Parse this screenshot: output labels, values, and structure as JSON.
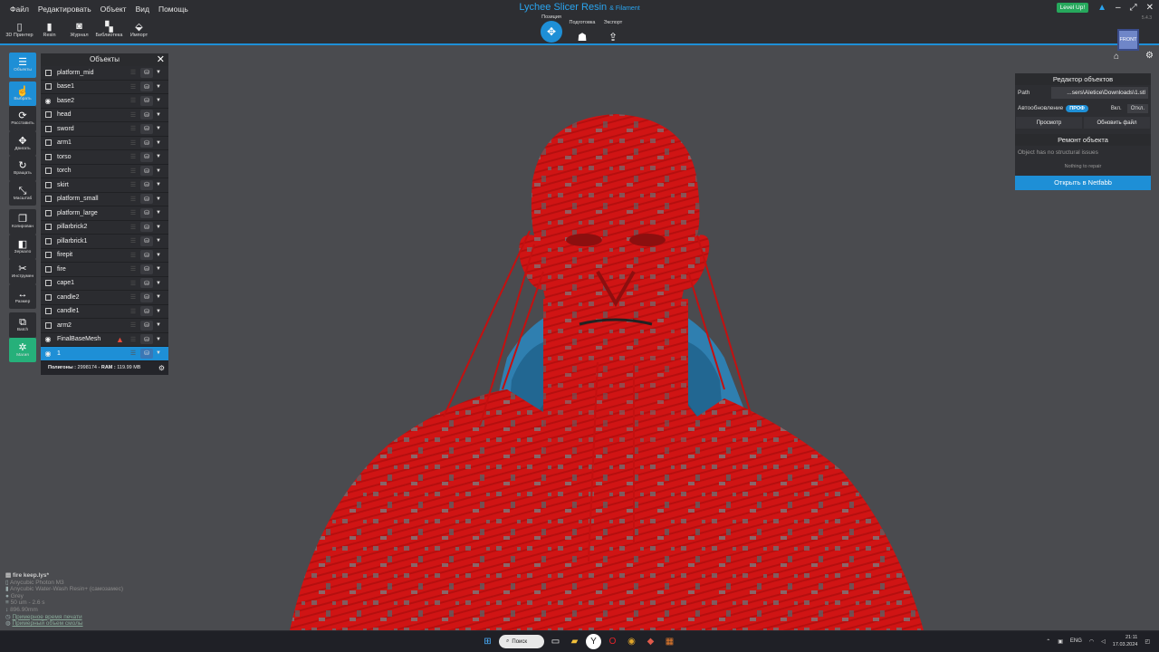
{
  "app": {
    "title": "Lychee Slicer Resin",
    "subtitle": "& Filament",
    "version": "5.4.3"
  },
  "menu": [
    "Файл",
    "Редактировать",
    "Объект",
    "Вид",
    "Помощь"
  ],
  "top_tools": [
    {
      "label": "3D Принтер",
      "icon": "printer-icon"
    },
    {
      "label": "Resin",
      "icon": "resin-bottle-icon"
    },
    {
      "label": "Журнал",
      "icon": "journal-icon"
    },
    {
      "label": "Библиотека",
      "icon": "library-icon"
    },
    {
      "label": "Импорт",
      "icon": "import-icon"
    }
  ],
  "modes": [
    {
      "label": "Позиция",
      "icon": "move-icon"
    },
    {
      "label": "Подготовка",
      "icon": "supports-icon"
    },
    {
      "label": "Экспорт",
      "icon": "export-icon"
    }
  ],
  "level_up": "Level Up!",
  "view_cube_label": "FRONT",
  "left_tools": [
    {
      "label": "Объекты",
      "icon": "objects-list-icon"
    },
    {
      "label": "Выбрать",
      "icon": "select-icon"
    },
    {
      "label": "Расставить",
      "icon": "arrange-icon"
    },
    {
      "label": "Двигать",
      "icon": "move-icon"
    },
    {
      "label": "Вращать",
      "icon": "rotate-icon"
    },
    {
      "label": "Масштаб",
      "icon": "scale-icon"
    },
    {
      "label": "Копирован",
      "icon": "copy-icon"
    },
    {
      "label": "Зеркало",
      "icon": "mirror-icon"
    },
    {
      "label": "Инструмен",
      "icon": "tools-icon"
    },
    {
      "label": "Размер",
      "icon": "size-icon"
    },
    {
      "label": "Batch",
      "icon": "batch-icon"
    },
    {
      "label": "Магия",
      "icon": "magic-icon"
    }
  ],
  "objects_panel": {
    "title": "Объекты",
    "items": [
      {
        "name": "platform_mid",
        "visible": false
      },
      {
        "name": "base1",
        "visible": false
      },
      {
        "name": "base2",
        "visible": true
      },
      {
        "name": "head",
        "visible": false
      },
      {
        "name": "sword",
        "visible": false
      },
      {
        "name": "arm1",
        "visible": false
      },
      {
        "name": "torso",
        "visible": false
      },
      {
        "name": "torch",
        "visible": false
      },
      {
        "name": "skirt",
        "visible": false
      },
      {
        "name": "platform_small",
        "visible": false
      },
      {
        "name": "platform_large",
        "visible": false
      },
      {
        "name": "pillarbrick2",
        "visible": false
      },
      {
        "name": "pillarbrick1",
        "visible": false
      },
      {
        "name": "firepit",
        "visible": false
      },
      {
        "name": "fire",
        "visible": false
      },
      {
        "name": "cape1",
        "visible": false
      },
      {
        "name": "candle2",
        "visible": false
      },
      {
        "name": "candle1",
        "visible": false
      },
      {
        "name": "arm2",
        "visible": false
      },
      {
        "name": "FinalBaseMesh",
        "visible": true,
        "warning": true
      },
      {
        "name": "1",
        "visible": true,
        "selected": true
      }
    ],
    "polygons_label": "Полигоны :",
    "polygons_value": "2998174",
    "ram_label": "- RAM :",
    "ram_value": "119.99 MB"
  },
  "object_editor": {
    "title": "Редактор объектов",
    "path_label": "Path",
    "path_value": "...sers\\Aletice\\Downloads\\1.stl",
    "autoupdate_label": "Автообновление",
    "prof_badge": "ПРОФ",
    "on_label": "Вкл.",
    "off_label": "Откл.",
    "preview_button": "Просмотр",
    "update_file_button": "Обновить файл"
  },
  "object_repair": {
    "title": "Ремонт объекта",
    "message": "Object has no structural issues",
    "sub": "Nothing to repair",
    "netfabb_button": "Открыть в Netfabb"
  },
  "scene_info": {
    "file": "fire keep.lys*",
    "printer": "Anycubic Photon M3",
    "resin": "Anycubic Water-Wash Resin+ (самозамес)",
    "color": "Grey",
    "layer": "50 um - 2.6 s",
    "height": "896.90mm",
    "print_time": "Примерное время печати",
    "resin_volume": "Примерный объем смолы"
  },
  "taskbar": {
    "search": "Поиск",
    "lang": "ENG",
    "time": "21:11",
    "date": "17.03.2024"
  },
  "colors": {
    "accent": "#1e8fd6",
    "model_red": "#d01414",
    "model_blue": "#2f7fb0",
    "magic_green": "#26b07a"
  }
}
